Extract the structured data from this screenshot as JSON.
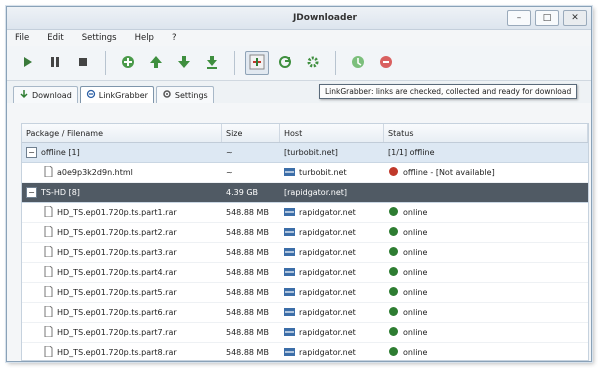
{
  "window": {
    "title": "JDownloader"
  },
  "menu": [
    "File",
    "Edit",
    "Settings",
    "Help",
    "?"
  ],
  "tabs": [
    {
      "label": "Download",
      "active": false
    },
    {
      "label": "LinkGrabber",
      "active": true
    },
    {
      "label": "Settings",
      "active": false
    }
  ],
  "tooltip": "LinkGrabber: links are checked, collected and ready for download",
  "columns": [
    "Package / Filename",
    "Size",
    "Host",
    "Status"
  ],
  "packages": [
    {
      "name": "offline [1]",
      "size": "~",
      "host": "[turbobit.net]",
      "status": "[1/1] offline",
      "selected": false,
      "expanded": "−",
      "files": [
        {
          "name": "a0e9p3k2d9n.html",
          "size": "~",
          "host": "turbobit.net",
          "status": "offline - [Not available]",
          "status_color": "#c0392b"
        }
      ]
    },
    {
      "name": "TS-HD [8]",
      "size": "4.39 GB",
      "host": "[rapidgator.net]",
      "status": "",
      "selected": true,
      "expanded": "−",
      "files": [
        {
          "name": "HD_TS.ep01.720p.ts.part1.rar",
          "size": "548.88 MB",
          "host": "rapidgator.net",
          "status": "online",
          "status_color": "#2e7d32"
        },
        {
          "name": "HD_TS.ep01.720p.ts.part2.rar",
          "size": "548.88 MB",
          "host": "rapidgator.net",
          "status": "online",
          "status_color": "#2e7d32"
        },
        {
          "name": "HD_TS.ep01.720p.ts.part3.rar",
          "size": "548.88 MB",
          "host": "rapidgator.net",
          "status": "online",
          "status_color": "#2e7d32"
        },
        {
          "name": "HD_TS.ep01.720p.ts.part4.rar",
          "size": "548.88 MB",
          "host": "rapidgator.net",
          "status": "online",
          "status_color": "#2e7d32"
        },
        {
          "name": "HD_TS.ep01.720p.ts.part5.rar",
          "size": "548.88 MB",
          "host": "rapidgator.net",
          "status": "online",
          "status_color": "#2e7d32"
        },
        {
          "name": "HD_TS.ep01.720p.ts.part6.rar",
          "size": "548.88 MB",
          "host": "rapidgator.net",
          "status": "online",
          "status_color": "#2e7d32"
        },
        {
          "name": "HD_TS.ep01.720p.ts.part7.rar",
          "size": "548.88 MB",
          "host": "rapidgator.net",
          "status": "online",
          "status_color": "#2e7d32"
        },
        {
          "name": "HD_TS.ep01.720p.ts.part8.rar",
          "size": "548.88 MB",
          "host": "rapidgator.net",
          "status": "online",
          "status_color": "#2e7d32"
        }
      ]
    }
  ],
  "toolbar": [
    {
      "icon": "play-icon",
      "active": false
    },
    {
      "icon": "pause-icon",
      "active": false
    },
    {
      "icon": "stop-icon",
      "active": false
    },
    {
      "sep": true
    },
    {
      "icon": "add-icon",
      "active": false
    },
    {
      "icon": "move-up-icon",
      "active": false
    },
    {
      "icon": "move-down-icon",
      "active": false
    },
    {
      "icon": "move-bottom-icon",
      "active": false
    },
    {
      "sep": true
    },
    {
      "icon": "linkgrabber-icon",
      "active": true
    },
    {
      "icon": "reconnect-icon",
      "active": false
    },
    {
      "icon": "settings-icon",
      "active": false
    },
    {
      "sep": true
    },
    {
      "icon": "update-icon",
      "active": false
    },
    {
      "icon": "premium-icon",
      "active": false
    }
  ]
}
